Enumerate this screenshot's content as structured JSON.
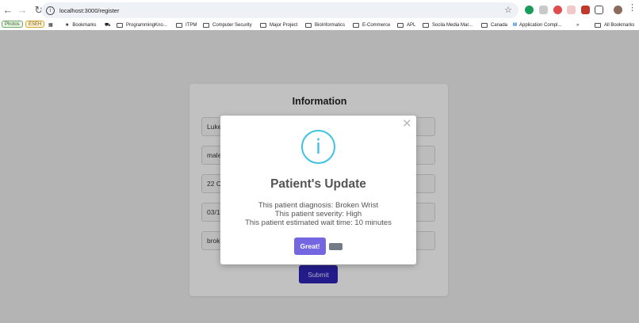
{
  "browser": {
    "url": "localhost:3000/register",
    "bookmarks": {
      "photos": "Photos",
      "eseh": "ESEH",
      "bookmarks": "Bookmarks",
      "programming": "ProgrammingKno...",
      "itpm": "ITPM",
      "computer_security": "Computer Security",
      "major_project": "Major Project",
      "bioinformatics": "BioInformatics",
      "ecommerce": "E-Commerce",
      "apl": "APL",
      "social_media": "Socila Media Mar...",
      "canada": "Canada",
      "application": "Application Compl...",
      "more": "»",
      "all_bookmarks": "All Bookmarks"
    }
  },
  "form": {
    "title": "Information",
    "fields": [
      "Luke",
      "male",
      "22 C",
      "03/1",
      "brok"
    ],
    "submit_label": "Submit"
  },
  "modal": {
    "title": "Patient's Update",
    "lines": [
      "This patient diagnosis: Broken Wrist",
      "This patient severity: High",
      "This patient estimated wait time: 10 minutes"
    ],
    "confirm_label": "Great!",
    "icon_glyph": "i",
    "close_glyph": "✕"
  }
}
